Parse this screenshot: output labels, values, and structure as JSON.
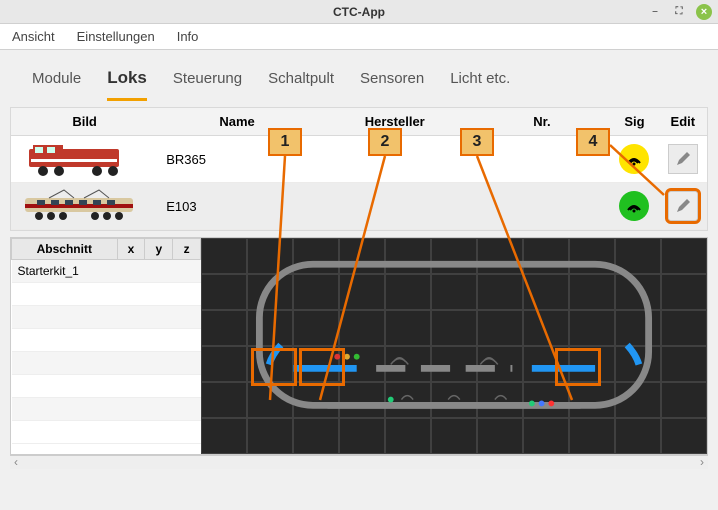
{
  "window": {
    "title": "CTC-App"
  },
  "menu": {
    "ansicht": "Ansicht",
    "einstellungen": "Einstellungen",
    "info": "Info"
  },
  "tabs": {
    "module": "Module",
    "loks": "Loks",
    "steuerung": "Steuerung",
    "schaltpult": "Schaltpult",
    "sensoren": "Sensoren",
    "licht": "Licht etc."
  },
  "loks_header": {
    "bild": "Bild",
    "name": "Name",
    "hersteller": "Hersteller",
    "nr": "Nr.",
    "sig": "Sig",
    "edit": "Edit"
  },
  "loks": [
    {
      "name": "BR365",
      "hersteller": "",
      "nr": "",
      "sig_color": "yellow"
    },
    {
      "name": "E103",
      "hersteller": "",
      "nr": "",
      "sig_color": "green"
    }
  ],
  "sections_header": {
    "abschnitt": "Abschnitt",
    "x": "x",
    "y": "y",
    "z": "z"
  },
  "sections": [
    {
      "name": "Starterkit_1"
    }
  ],
  "callouts": {
    "c1": "1",
    "c2": "2",
    "c3": "3",
    "c4": "4"
  }
}
